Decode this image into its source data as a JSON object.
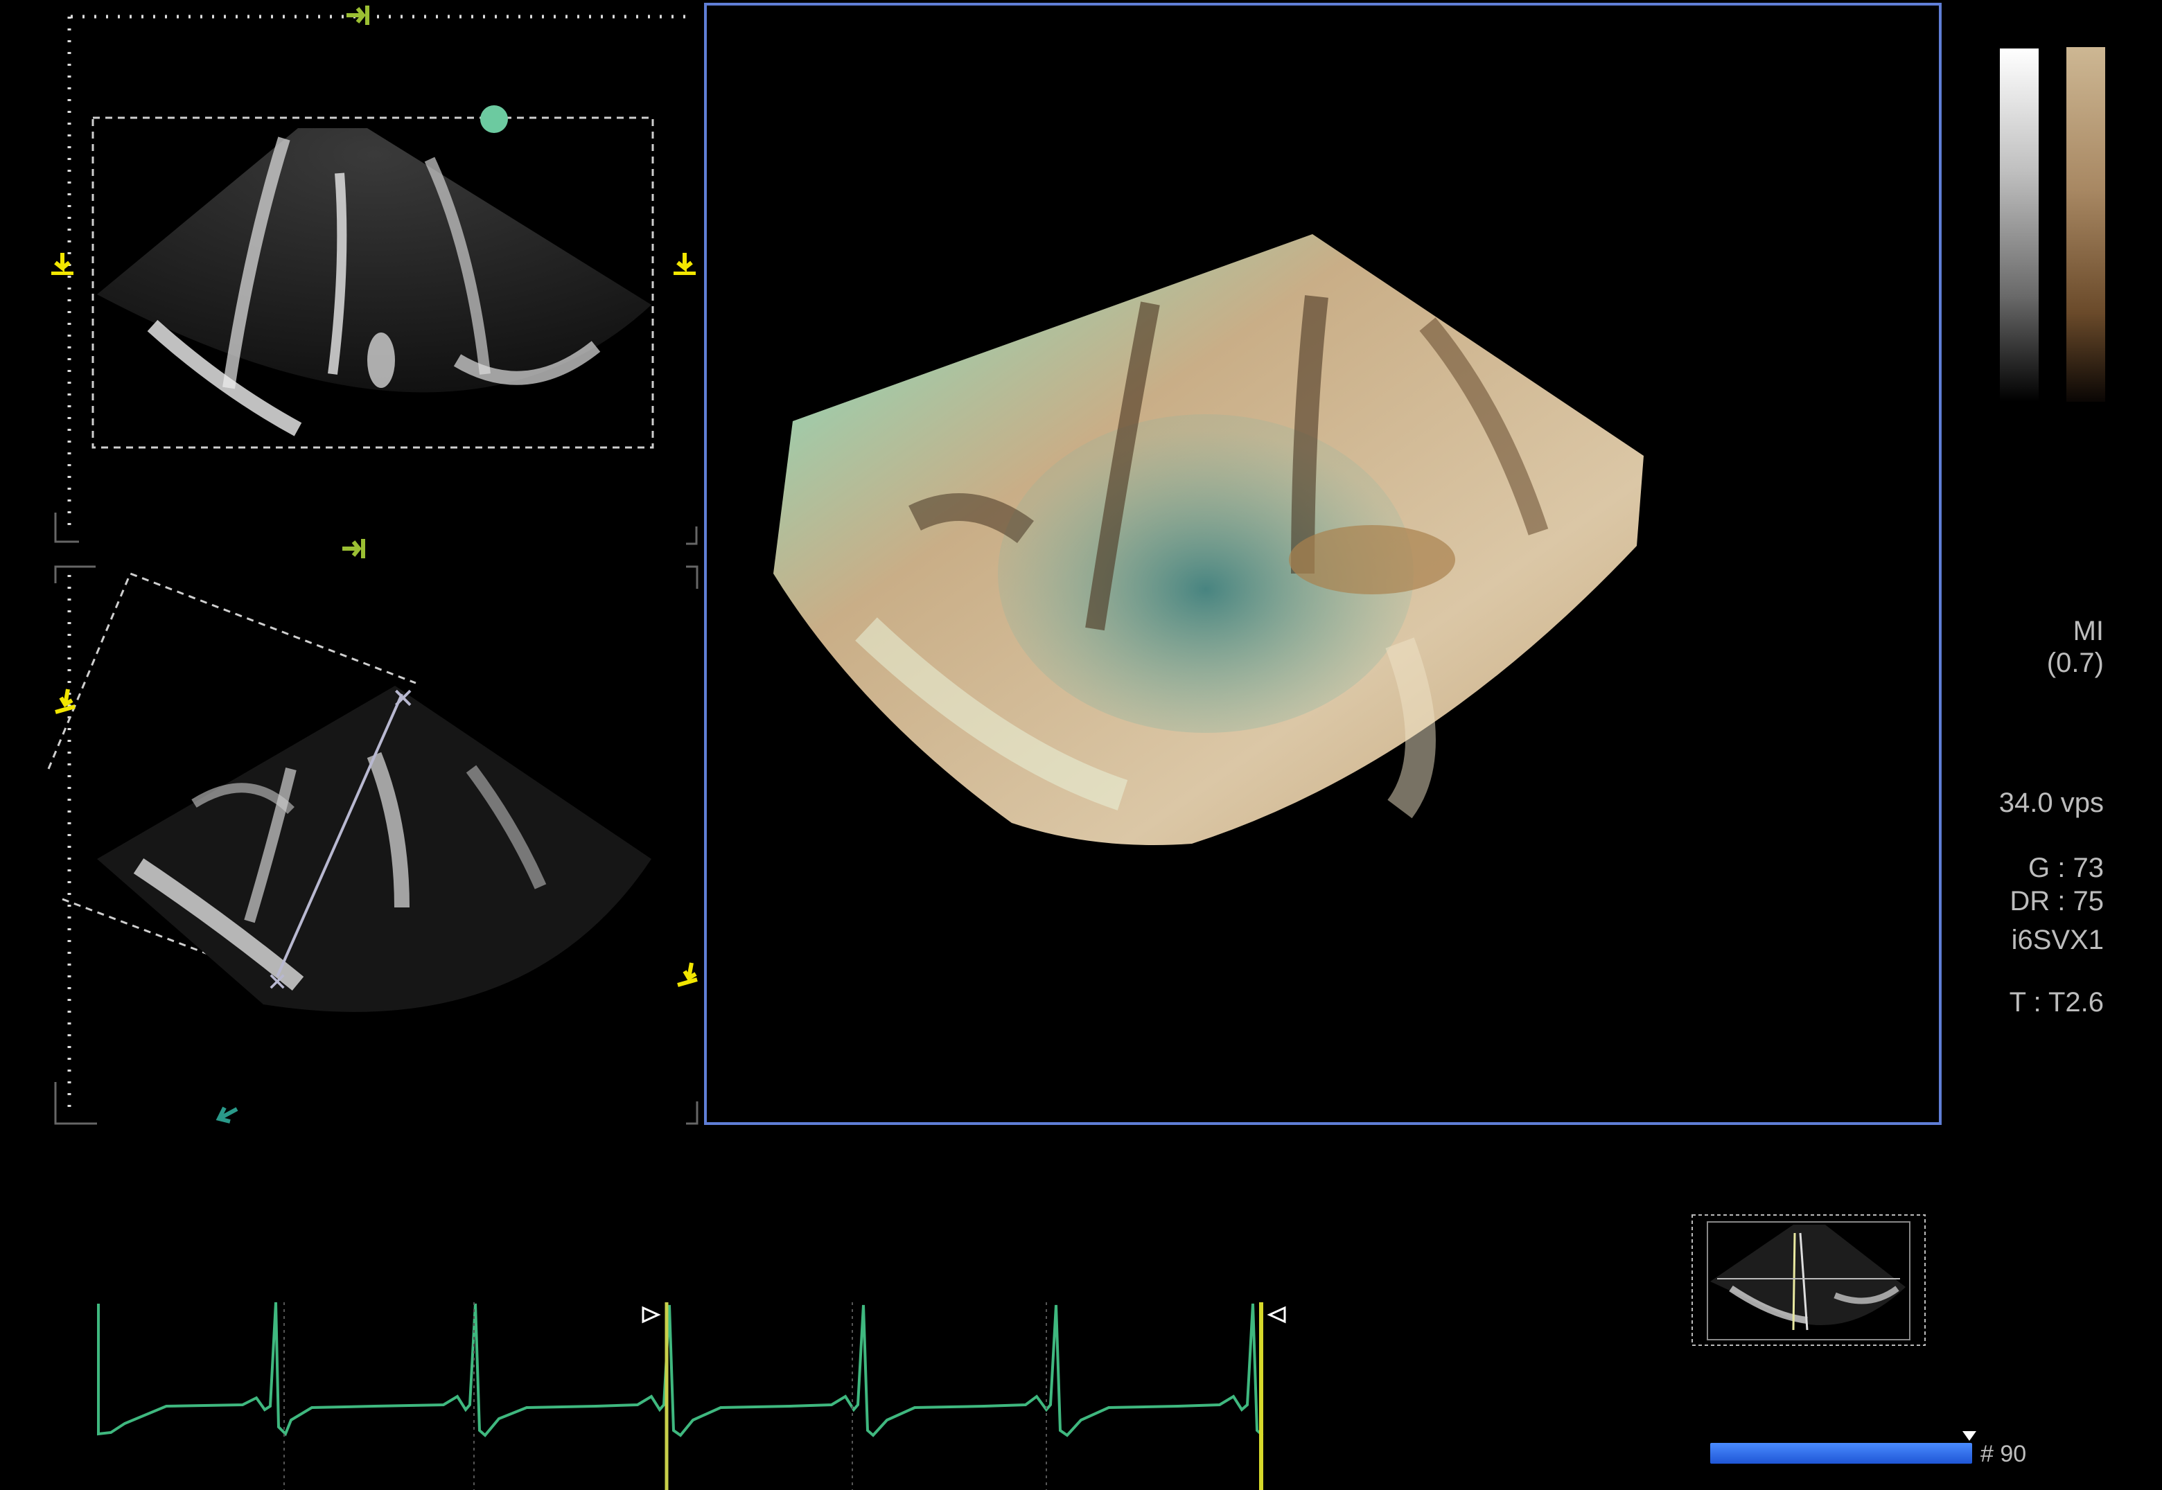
{
  "readouts": {
    "mi_label": "MI",
    "mi_value": "(0.7)",
    "volume_rate": "34.0 vps",
    "gain": "G : 73",
    "dynamic_range": "DR : 75",
    "probe": "i6SVX1",
    "temperature": "T : T2.6"
  },
  "cine": {
    "frame_label": "# 90",
    "progress_fraction": 1.0
  },
  "colors": {
    "viewport_border": "#5f7ed6",
    "ecg_trace": "#3fb87f",
    "marker_yellow": "#f2e600",
    "marker_green": "#9bbf33",
    "marker_teal": "#2a9a8a",
    "cine_bar": "#2d6ae8"
  },
  "icons": {
    "volume_handle": "circle-handle-icon",
    "plane_marker": "arrow-marker-icon",
    "view_thumbnail": "volume-thumbnail-icon"
  }
}
